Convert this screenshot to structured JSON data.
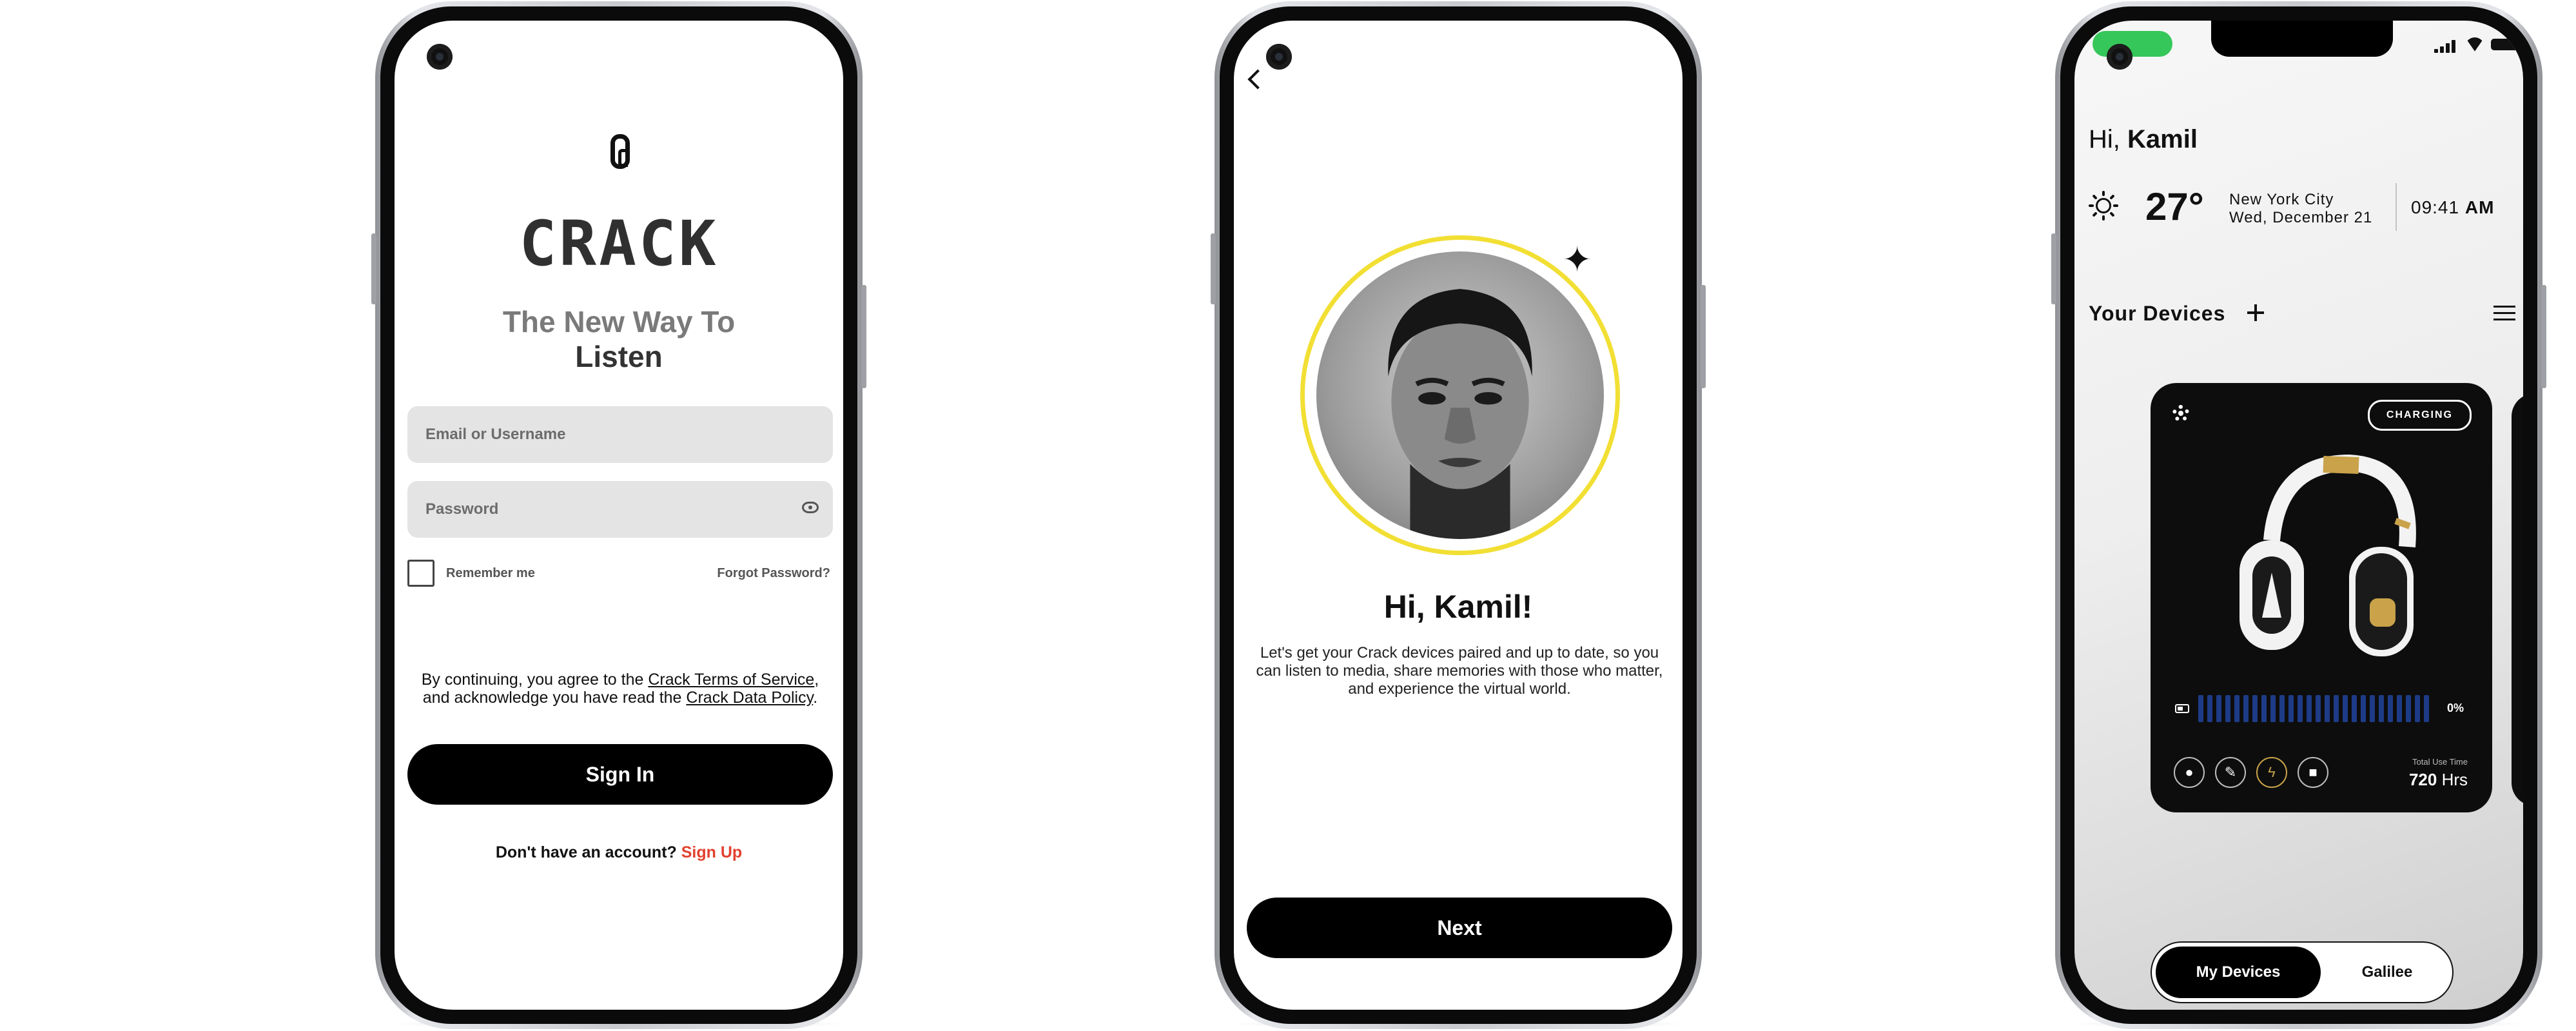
{
  "login": {
    "brand": "CRACK",
    "tagline_line1": "The New Way To",
    "tagline_line2": "Listen",
    "email_placeholder": "Email or Username",
    "password_placeholder": "Password",
    "remember_label": "Remember me",
    "forgot_label": "Forgot Password?",
    "terms_prefix": "By continuing, you agree to the ",
    "terms_link": "Crack Terms of Service",
    "terms_middle": ", and acknowledge you have read the ",
    "policy_link": "Crack Data Policy",
    "terms_suffix": ".",
    "sign_in_label": "Sign In",
    "no_account_text": "Don't have an account?",
    "sign_up_label": "Sign Up"
  },
  "welcome": {
    "greeting": "Hi, Kamil!",
    "blurb": "Let's get your Crack devices paired and up to date, so you can listen to media, share memories with those who matter, and experience the virtual world.",
    "next_label": "Next"
  },
  "home": {
    "hi_prefix": "Hi,",
    "user_name": "Kamil",
    "temperature": "27°",
    "city": "New York City",
    "date": "Wed, December 21",
    "time": "09:41",
    "ampm": "AM",
    "devices_heading": "Your Devices",
    "charging_badge": "CHARGING",
    "battery_percent": "0%",
    "total_use_label": "Total Use Time",
    "total_use_value": "720",
    "total_use_unit": "Hrs",
    "tab_my_devices": "My Devices",
    "tab_galilee": "Galilee"
  },
  "colors": {
    "accent_red": "#e2412f",
    "avatar_ring": "#f2df34",
    "status_pill": "#36c75a",
    "battery_bar": "#1d3b86"
  },
  "icons": [
    "camera-icon",
    "eye-icon",
    "back-icon",
    "sparkle-icon",
    "sun-icon",
    "plus-icon",
    "list-icon",
    "gear-icon",
    "location-icon",
    "wrench-icon",
    "bolt-icon",
    "lock-icon"
  ]
}
